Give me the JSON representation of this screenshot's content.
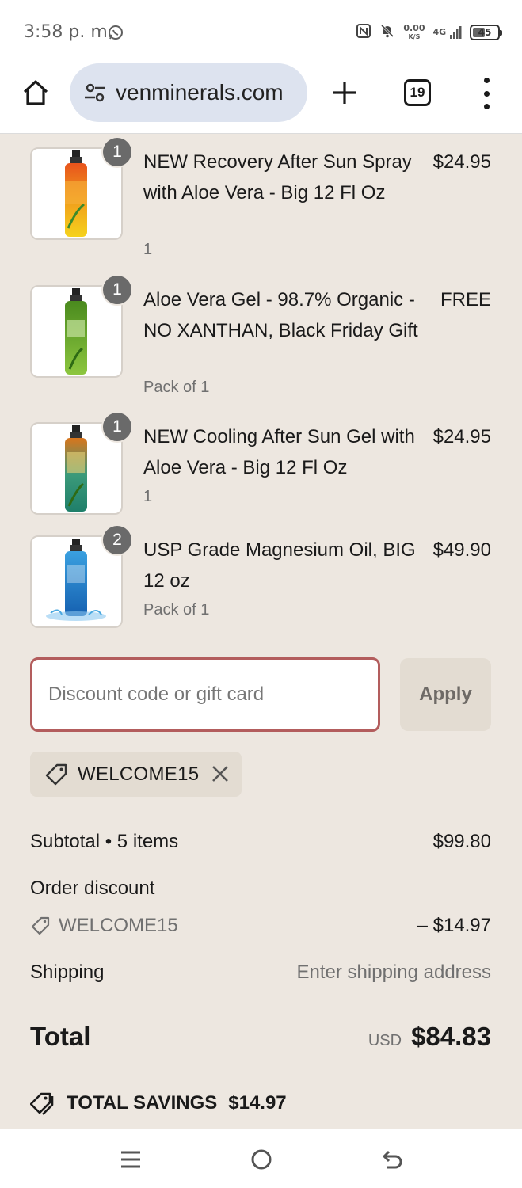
{
  "status_bar": {
    "time": "3:58 p. m.",
    "net_speed_value": "0.00",
    "net_speed_unit": "K/S",
    "network": "4G",
    "battery": "45"
  },
  "browser": {
    "url": "venminerals.com",
    "tab_count": "19"
  },
  "items": [
    {
      "name": "NEW Recovery After Sun Spray with Aloe Vera - Big 12 Fl Oz",
      "variant": "1",
      "price": "$24.95",
      "quantity": "1"
    },
    {
      "name": "Aloe Vera Gel - 98.7% Organic - NO XANTHAN, Black Friday Gift",
      "variant": "Pack of 1",
      "price": "FREE",
      "quantity": "1"
    },
    {
      "name": "NEW Cooling After Sun Gel with Aloe Vera - Big 12 Fl Oz",
      "variant": "1",
      "price": "$24.95",
      "quantity": "1"
    },
    {
      "name": "USP Grade Magnesium Oil, BIG 12 oz",
      "variant": "Pack of 1",
      "price": "$49.90",
      "quantity": "2"
    }
  ],
  "discount": {
    "placeholder": "Discount code or gift card",
    "apply_label": "Apply",
    "applied_code": "WELCOME15"
  },
  "summary": {
    "subtotal_label": "Subtotal • 5 items",
    "subtotal_value": "$99.80",
    "order_discount_label": "Order discount",
    "discount_code": "WELCOME15",
    "discount_value": "– $14.97",
    "shipping_label": "Shipping",
    "shipping_value": "Enter shipping address",
    "total_label": "Total",
    "currency": "USD",
    "total_value": "$84.83",
    "savings_label": "TOTAL SAVINGS",
    "savings_value": "$14.97"
  },
  "colors": {
    "page_bg": "#ede7e0",
    "input_border": "#b35d5d",
    "chip_bg": "#e3dcd2"
  }
}
